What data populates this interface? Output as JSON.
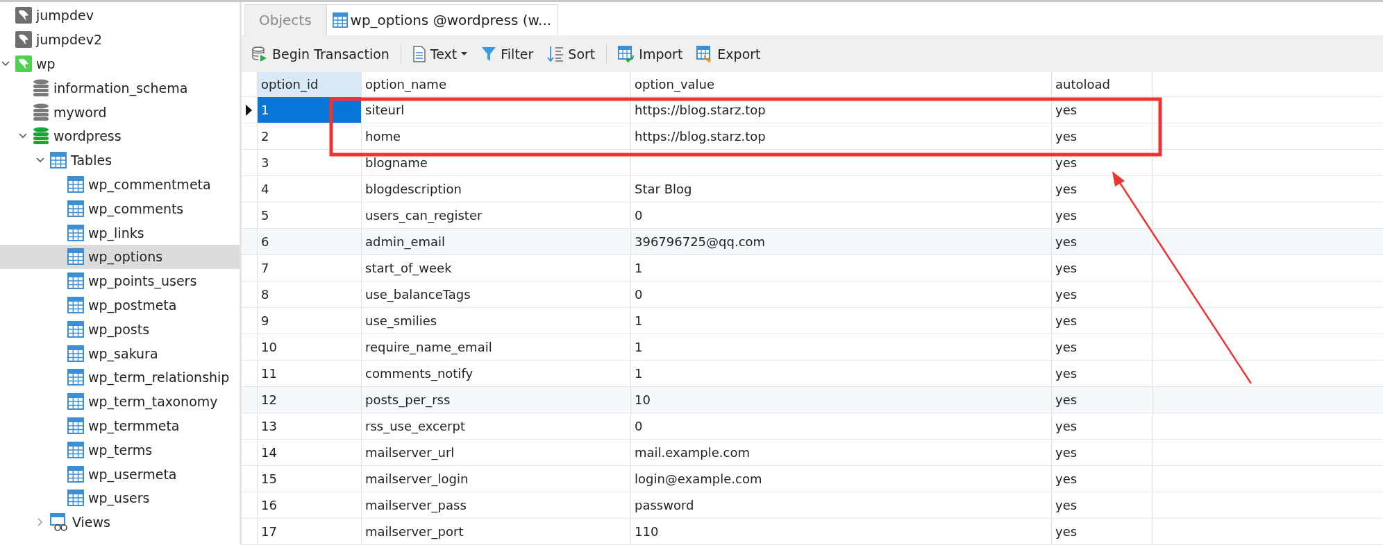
{
  "sidebar": {
    "items": [
      {
        "kind": "connection",
        "label": "jumpdev",
        "open": false,
        "selected": false
      },
      {
        "kind": "connection",
        "label": "jumpdev2",
        "open": false,
        "selected": false
      },
      {
        "kind": "connection",
        "label": "wp",
        "open": true,
        "expanded": true,
        "selected": false,
        "children": [
          {
            "kind": "database",
            "label": "information_schema",
            "open": false,
            "selected": false
          },
          {
            "kind": "database",
            "label": "myword",
            "open": false,
            "selected": false
          },
          {
            "kind": "database",
            "label": "wordpress",
            "open": true,
            "expanded": true,
            "selected": false,
            "children": [
              {
                "kind": "tables",
                "label": "Tables",
                "expanded": true,
                "selected": false,
                "children": [
                  {
                    "kind": "table",
                    "label": "wp_commentmeta",
                    "selected": false
                  },
                  {
                    "kind": "table",
                    "label": "wp_comments",
                    "selected": false
                  },
                  {
                    "kind": "table",
                    "label": "wp_links",
                    "selected": false
                  },
                  {
                    "kind": "table",
                    "label": "wp_options",
                    "selected": true
                  },
                  {
                    "kind": "table",
                    "label": "wp_points_users",
                    "selected": false
                  },
                  {
                    "kind": "table",
                    "label": "wp_postmeta",
                    "selected": false
                  },
                  {
                    "kind": "table",
                    "label": "wp_posts",
                    "selected": false
                  },
                  {
                    "kind": "table",
                    "label": "wp_sakura",
                    "selected": false
                  },
                  {
                    "kind": "table",
                    "label": "wp_term_relationship",
                    "selected": false
                  },
                  {
                    "kind": "table",
                    "label": "wp_term_taxonomy",
                    "selected": false
                  },
                  {
                    "kind": "table",
                    "label": "wp_termmeta",
                    "selected": false
                  },
                  {
                    "kind": "table",
                    "label": "wp_terms",
                    "selected": false
                  },
                  {
                    "kind": "table",
                    "label": "wp_usermeta",
                    "selected": false
                  },
                  {
                    "kind": "table",
                    "label": "wp_users",
                    "selected": false
                  }
                ]
              },
              {
                "kind": "views",
                "label": "Views",
                "expanded": false,
                "selected": false
              }
            ]
          }
        ]
      }
    ]
  },
  "tabs": [
    {
      "label": "Objects",
      "selected": false
    },
    {
      "label": "wp_options @wordpress (w...",
      "selected": true
    }
  ],
  "toolbar": [
    {
      "kind": "transaction",
      "label": "Begin Transaction"
    },
    {
      "kind": "text",
      "label": "Text"
    },
    {
      "kind": "filter",
      "label": "Filter"
    },
    {
      "kind": "sort",
      "label": "Sort"
    },
    {
      "kind": "import",
      "label": "Import"
    },
    {
      "kind": "export",
      "label": "Export"
    }
  ],
  "table": {
    "columns": [
      {
        "label": "option_id",
        "selected": true
      },
      {
        "label": "option_name",
        "selected": false
      },
      {
        "label": "option_value",
        "selected": false
      },
      {
        "label": "autoload",
        "selected": false
      }
    ],
    "rows": [
      {
        "cells": [
          "1",
          "siteurl",
          "https://blog.starz.top",
          "yes"
        ],
        "selected": true
      },
      {
        "cells": [
          "2",
          "home",
          "https://blog.starz.top",
          "yes"
        ],
        "selected": false
      },
      {
        "cells": [
          "3",
          "blogname",
          "",
          "yes"
        ],
        "selected": false
      },
      {
        "cells": [
          "4",
          "blogdescription",
          "Star Blog",
          "yes"
        ],
        "selected": false
      },
      {
        "cells": [
          "5",
          "users_can_register",
          "0",
          "yes"
        ],
        "selected": false
      },
      {
        "cells": [
          "6",
          "admin_email",
          "396796725@qq.com",
          "yes"
        ],
        "selected": false
      },
      {
        "cells": [
          "7",
          "start_of_week",
          "1",
          "yes"
        ],
        "selected": false
      },
      {
        "cells": [
          "8",
          "use_balanceTags",
          "0",
          "yes"
        ],
        "selected": false
      },
      {
        "cells": [
          "9",
          "use_smilies",
          "1",
          "yes"
        ],
        "selected": false
      },
      {
        "cells": [
          "10",
          "require_name_email",
          "1",
          "yes"
        ],
        "selected": false
      },
      {
        "cells": [
          "11",
          "comments_notify",
          "1",
          "yes"
        ],
        "selected": false
      },
      {
        "cells": [
          "12",
          "posts_per_rss",
          "10",
          "yes"
        ],
        "selected": false
      },
      {
        "cells": [
          "13",
          "rss_use_excerpt",
          "0",
          "yes"
        ],
        "selected": false
      },
      {
        "cells": [
          "14",
          "mailserver_url",
          "mail.example.com",
          "yes"
        ],
        "selected": false
      },
      {
        "cells": [
          "15",
          "mailserver_login",
          "login@example.com",
          "yes"
        ],
        "selected": false
      },
      {
        "cells": [
          "16",
          "mailserver_pass",
          "password",
          "yes"
        ],
        "selected": false
      },
      {
        "cells": [
          "17",
          "mailserver_port",
          "110",
          "yes"
        ],
        "selected": false
      }
    ]
  }
}
